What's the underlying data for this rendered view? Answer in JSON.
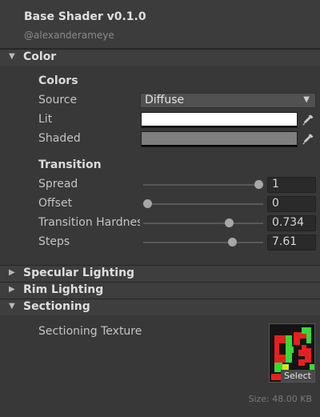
{
  "header": {
    "title": "Base Shader v0.1.0",
    "subtitle": "@alexanderameye"
  },
  "sections": {
    "color": {
      "label": "Color",
      "expanded": true
    },
    "specular": {
      "label": "Specular Lighting",
      "expanded": false
    },
    "rim": {
      "label": "Rim Lighting",
      "expanded": false
    },
    "sectioning": {
      "label": "Sectioning",
      "expanded": true
    }
  },
  "colors": {
    "heading": "Colors",
    "source_label": "Source",
    "source_value": "Diffuse",
    "lit_label": "Lit",
    "lit_color": "#ffffff",
    "shaded_label": "Shaded",
    "shaded_color": "#7f7f7f"
  },
  "transition": {
    "heading": "Transition",
    "spread": {
      "label": "Spread",
      "value": "1",
      "fraction": 1.0
    },
    "offset": {
      "label": "Offset",
      "value": "0",
      "fraction": 0.0
    },
    "hardness": {
      "label": "Transition Hardness",
      "value": "0.734",
      "fraction": 0.734
    },
    "steps": {
      "label": "Steps",
      "value": "7.61",
      "fraction": 0.76
    }
  },
  "sectioning": {
    "texture_label": "Sectioning Texture",
    "select_label": "Select",
    "size_label": "Size: 48.00 KB"
  },
  "icons": {
    "expanded": "triangle-down-icon",
    "collapsed": "triangle-right-icon",
    "picker": "eyedropper-icon"
  }
}
